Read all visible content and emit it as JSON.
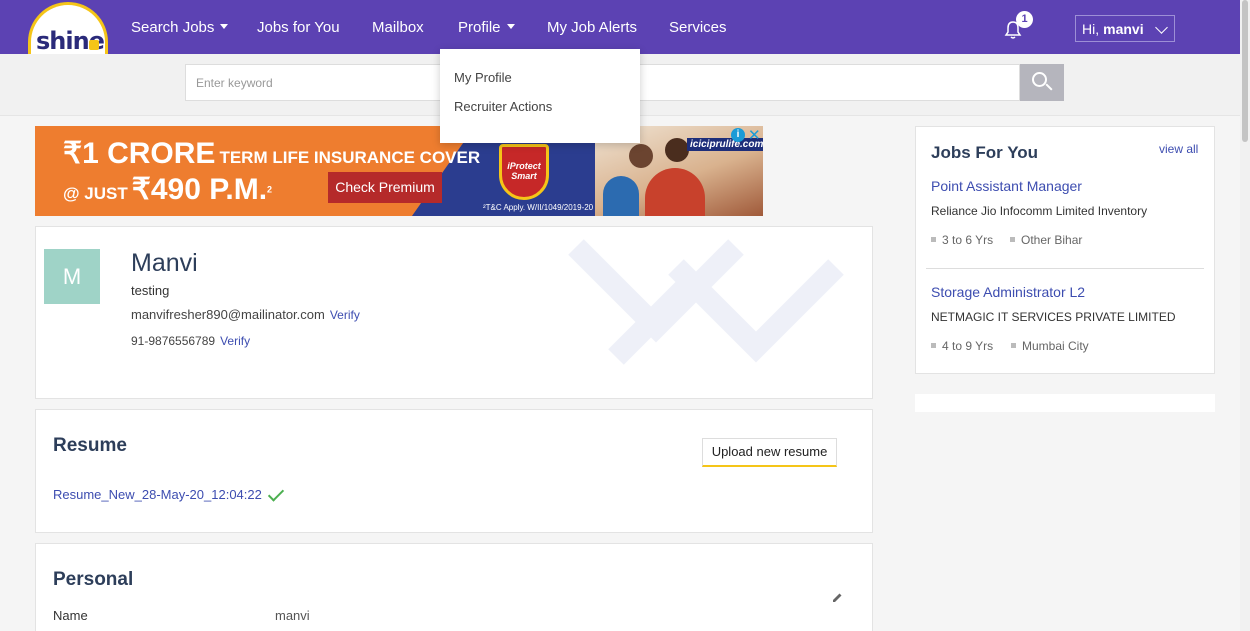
{
  "logo": {
    "text": "shine"
  },
  "nav": {
    "items": [
      {
        "label": "Search Jobs",
        "has_caret": true
      },
      {
        "label": "Jobs for You"
      },
      {
        "label": "Mailbox"
      },
      {
        "label": "Profile",
        "has_caret": true
      },
      {
        "label": "My Job Alerts"
      },
      {
        "label": "Services"
      }
    ],
    "notification_count": "1",
    "greeting": "Hi,",
    "user": "manvi",
    "icons": {
      "bell": "bell-icon",
      "chevron": "chevron-down-icon"
    }
  },
  "search": {
    "placeholder": "Enter keyword",
    "button_icon": "search-icon"
  },
  "profile_dropdown": {
    "items": [
      "My Profile",
      "Recruiter Actions"
    ]
  },
  "ad": {
    "line1_big": "₹1 CRORE",
    "line1_small": "TERM LIFE INSURANCE COVER",
    "line2_small": "@ JUST",
    "line2_big": "₹490 P.M.",
    "superscript": "2",
    "button": "Check Premium",
    "shield_text": "iProtect Smart",
    "brand": "iciciprulife.com",
    "terms": "²T&C Apply. W/II/1049/2019-20",
    "ad_choice": "i",
    "close": "✕",
    "colors": {
      "background": "#ee7d2f",
      "stripe": "#2b3d8f",
      "button": "#b52a2a"
    }
  },
  "profile": {
    "avatar_letter": "M",
    "name": "Manvi",
    "headline": "testing",
    "email": "manvifresher890@mailinator.com",
    "email_verify": "Verify",
    "phone": "91-9876556789",
    "phone_verify": "Verify",
    "avatar_color": "#9fd3c7"
  },
  "resume": {
    "title": "Resume",
    "upload_label": "Upload new resume",
    "file_name": "Resume_New_28-May-20_12:04:22",
    "status_icon": "checkmark-icon"
  },
  "personal": {
    "title": "Personal",
    "edit_icon": "pencil-icon",
    "fields": [
      {
        "label": "Name",
        "value": "manvi"
      }
    ]
  },
  "jobs_for_you": {
    "title": "Jobs For You",
    "view_all": "view all",
    "jobs": [
      {
        "title": "Point Assistant Manager",
        "company": "Reliance Jio Infocomm Limited Inventory",
        "experience": "3 to 6 Yrs",
        "location": "Other Bihar"
      },
      {
        "title": "Storage Administrator L2",
        "company": "NETMAGIC IT SERVICES PRIVATE LIMITED",
        "experience": "4 to 9 Yrs",
        "location": "Mumbai City"
      }
    ]
  },
  "colors": {
    "nav_bg": "#5c42b3",
    "link": "#3d4db0",
    "heading": "#2d3e5a",
    "accent": "#f5c518"
  }
}
